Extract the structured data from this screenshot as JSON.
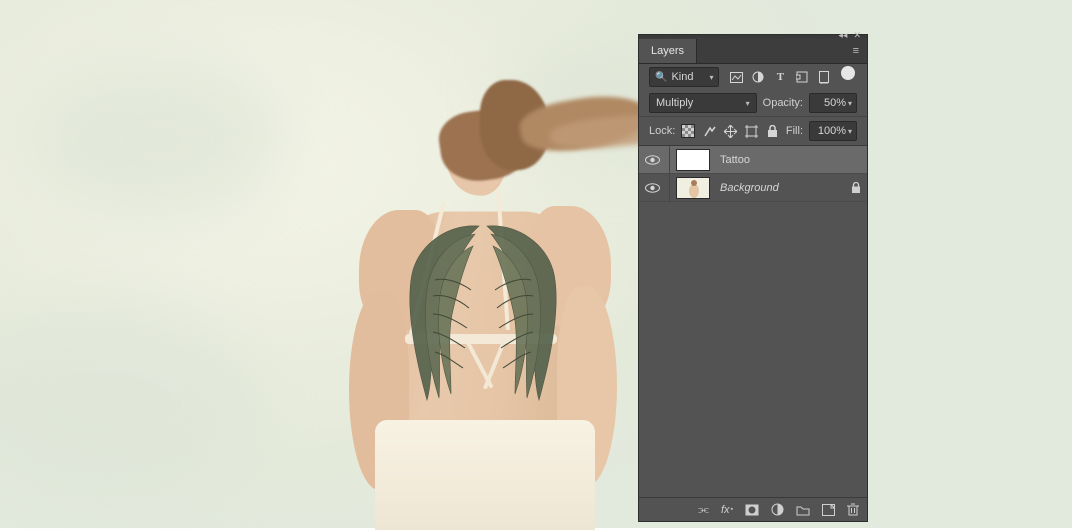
{
  "panel": {
    "tab_label": "Layers",
    "search": {
      "placeholder": "Kind"
    },
    "filter_icons": [
      "image-icon",
      "adjustment-icon",
      "type-icon",
      "shape-icon",
      "smartobject-icon"
    ],
    "blend_mode": "Multiply",
    "opacity_label": "Opacity:",
    "opacity_value": "50%",
    "lock_label": "Lock:",
    "fill_label": "Fill:",
    "fill_value": "100%",
    "lock_icons": [
      "lock-transparency-icon",
      "lock-image-icon",
      "lock-position-icon",
      "lock-artboard-icon",
      "lock-all-icon"
    ],
    "layers": [
      {
        "visible": true,
        "name": "Tattoo",
        "thumb": "transparent",
        "selected": true,
        "locked": false,
        "italic": false
      },
      {
        "visible": true,
        "name": "Background",
        "thumb": "image",
        "selected": false,
        "locked": true,
        "italic": true
      }
    ],
    "bottom_icons": [
      "link-icon",
      "fx-icon",
      "mask-icon",
      "adjustment-layer-icon",
      "group-icon",
      "new-layer-icon",
      "delete-icon"
    ]
  }
}
